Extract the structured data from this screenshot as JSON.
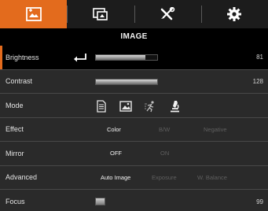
{
  "colors": {
    "accent": "#e36b1d",
    "background": "#2a2a2a",
    "selected_row": "#000000",
    "dim_text": "#5f5f5f"
  },
  "tabs": [
    {
      "icon": "image-adjust-icon",
      "active": true
    },
    {
      "icon": "display-icon",
      "active": false
    },
    {
      "icon": "tools-icon",
      "active": false
    },
    {
      "icon": "gear-icon",
      "active": false
    }
  ],
  "section_title": "IMAGE",
  "brightness": {
    "label": "Brightness",
    "value": "81",
    "level": 0.81,
    "enter_icon": "enter-icon"
  },
  "contrast": {
    "label": "Contrast",
    "value": "128",
    "level": 1.0
  },
  "mode": {
    "label": "Mode",
    "icons": [
      "document-icon",
      "photo-icon",
      "motion-icon",
      "microscope-icon"
    ],
    "selected": "microscope-icon"
  },
  "effect": {
    "label": "Effect",
    "options": [
      "Color",
      "B/W",
      "Negative"
    ],
    "selected": "Color"
  },
  "mirror": {
    "label": "Mirror",
    "options": [
      "OFF",
      "ON"
    ],
    "selected": "OFF"
  },
  "advanced": {
    "label": "Advanced",
    "options": [
      "Auto Image",
      "Exposure",
      "W. Balance"
    ],
    "selected": "Auto Image"
  },
  "focus": {
    "label": "Focus",
    "value": "99"
  }
}
